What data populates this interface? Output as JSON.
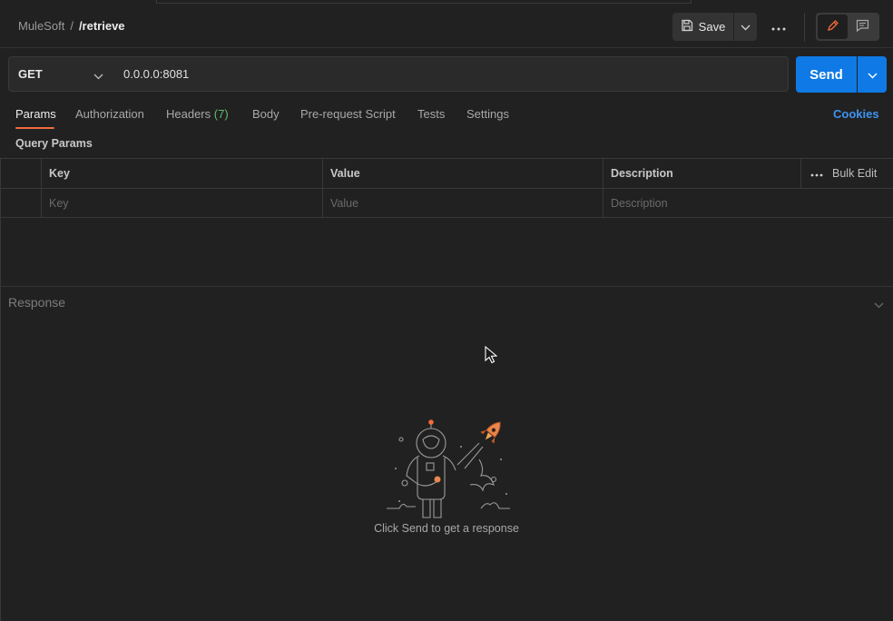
{
  "breadcrumb": {
    "parent": "MuleSoft",
    "separator": "/",
    "current": "/retrieve"
  },
  "toolbar": {
    "save_label": "Save"
  },
  "request": {
    "method": "GET",
    "url": "0.0.0.0:8081",
    "send_label": "Send"
  },
  "tabs": [
    {
      "label": "Params",
      "active": true
    },
    {
      "label": "Authorization"
    },
    {
      "label": "Headers",
      "count": "(7)"
    },
    {
      "label": "Body"
    },
    {
      "label": "Pre-request Script"
    },
    {
      "label": "Tests"
    },
    {
      "label": "Settings"
    }
  ],
  "cookies_label": "Cookies",
  "query_params": {
    "title": "Query Params",
    "columns": [
      "Key",
      "Value",
      "Description"
    ],
    "bulk_edit_label": "Bulk Edit",
    "placeholders": {
      "key": "Key",
      "value": "Value",
      "description": "Description"
    }
  },
  "response": {
    "title": "Response",
    "empty_message": "Click Send to get a response"
  },
  "colors": {
    "accent": "#0f7ae5",
    "tab_indicator": "#f26b3a",
    "headers_count": "#5fbf72",
    "link": "#3e94f0"
  }
}
